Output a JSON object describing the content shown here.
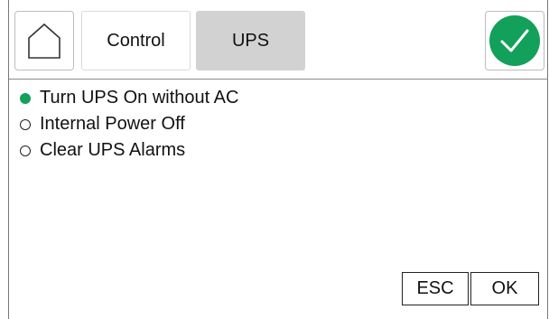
{
  "header": {
    "home_icon": "home-icon",
    "tabs": [
      {
        "label": "Control",
        "selected": false
      },
      {
        "label": "UPS",
        "selected": true
      }
    ],
    "confirm_icon": "checkmark-icon",
    "confirm_color": "#12a05a"
  },
  "options": [
    {
      "label": "Turn UPS On without AC",
      "selected": true
    },
    {
      "label": "Internal Power Off",
      "selected": false
    },
    {
      "label": "Clear UPS Alarms",
      "selected": false
    }
  ],
  "actions": {
    "esc_label": "ESC",
    "ok_label": "OK"
  },
  "colors": {
    "accent": "#12a05a",
    "selected_tab_bg": "#d2d2d2"
  }
}
